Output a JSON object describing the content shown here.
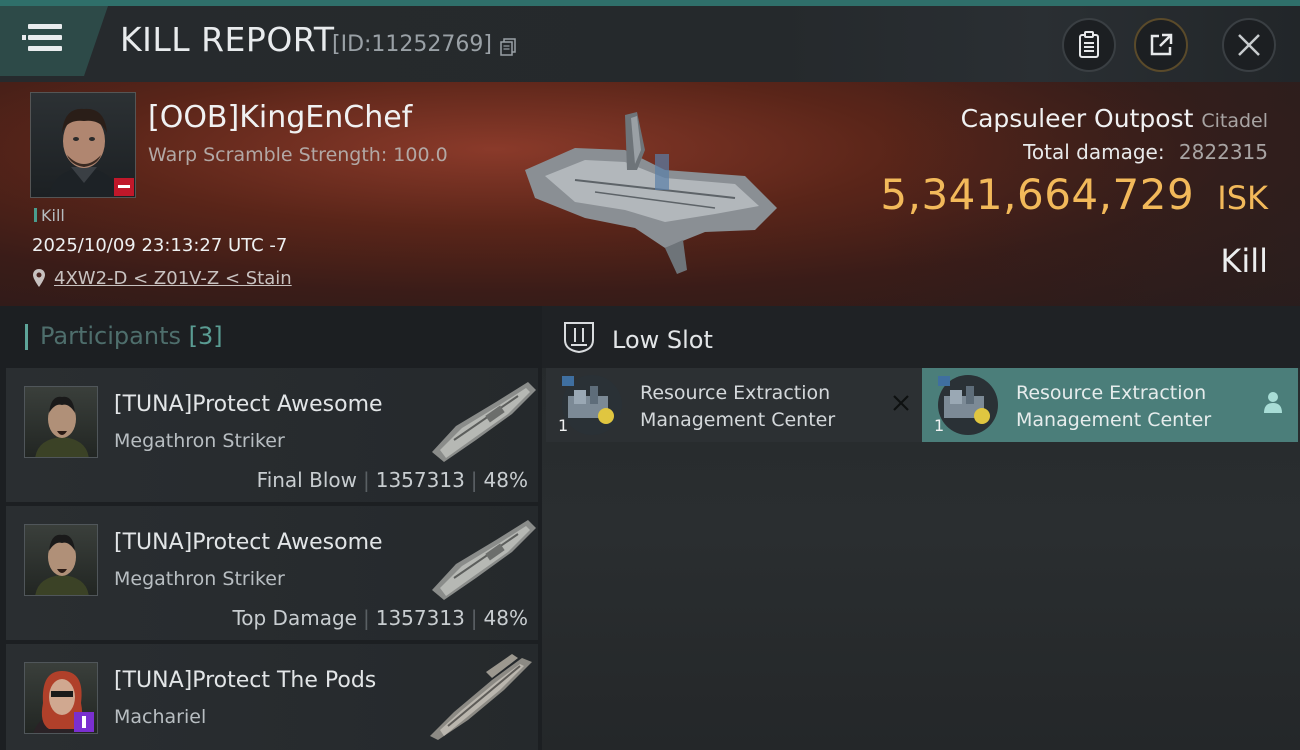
{
  "header": {
    "title": "KILL REPORT",
    "report_id": "[ID:11252769]"
  },
  "victim": {
    "name": "[OOB]KingEnChef",
    "attribute": "Warp Scramble Strength: 100.0",
    "result_tag": "Kill",
    "timestamp": "2025/10/09 23:13:27 UTC -7",
    "location": "4XW2-D < Z01V-Z < Stain",
    "structure_name": "Capsuleer Outpost",
    "structure_class": "Citadel",
    "total_damage_label": "Total damage:",
    "total_damage": "2822315",
    "isk_value": "5,341,664,729",
    "isk_unit": "ISK",
    "result": "Kill"
  },
  "participants": {
    "title": "Participants",
    "count": "[3]",
    "items": [
      {
        "name": "[TUNA]Protect Awesome",
        "ship": "Megathron Striker",
        "role": "Final Blow",
        "damage": "1357313",
        "percent": "48%"
      },
      {
        "name": "[TUNA]Protect Awesome",
        "ship": "Megathron Striker",
        "role": "Top Damage",
        "damage": "1357313",
        "percent": "48%"
      },
      {
        "name": "[TUNA]Protect The Pods",
        "ship": "Machariel"
      }
    ]
  },
  "slots": {
    "title": "Low Slot",
    "modules": [
      {
        "quantity": "1",
        "name_line1": "Resource Extraction",
        "name_line2": "Management Center",
        "state": "destroyed"
      },
      {
        "quantity": "1",
        "name_line1": "Resource Extraction",
        "name_line2": "Management Center",
        "state": "dropped"
      }
    ]
  },
  "colors": {
    "accent_teal": "#4b7e7a",
    "isk_gold": "#f2b95a",
    "badge_red": "#c0182a",
    "badge_purple": "#7a2fd0"
  }
}
